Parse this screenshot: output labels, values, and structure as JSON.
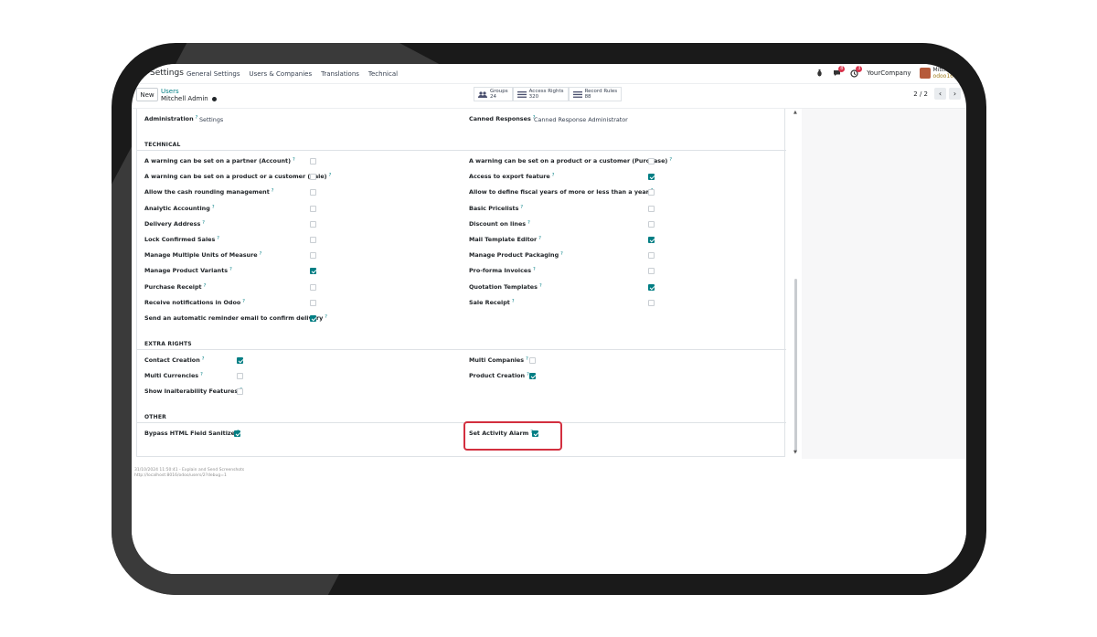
{
  "navbar": {
    "brand": "Settings",
    "menu": [
      "General Settings",
      "Users & Companies",
      "Translations",
      "Technical"
    ],
    "messages_badge": "8",
    "activity_badge": "3",
    "company": "YourCompany",
    "user_name": "Mitchel",
    "user_db": "odoo16"
  },
  "control_panel": {
    "new_label": "New",
    "breadcrumb_parent": "Users",
    "breadcrumb_current": "Mitchell Admin",
    "smart_buttons": [
      {
        "label": "Groups",
        "count": "24"
      },
      {
        "label": "Access Rights",
        "count": "320"
      },
      {
        "label": "Record Rules",
        "count": "88"
      }
    ],
    "pager": "2 / 2"
  },
  "form": {
    "admin_label": "Administration",
    "admin_value": "Settings",
    "canned_label": "Canned Responses",
    "canned_value": "Canned Response Administrator",
    "sections": {
      "technical": "TECHNICAL",
      "extra": "EXTRA RIGHTS",
      "other": "OTHER"
    },
    "technical_left": [
      {
        "label": "A warning can be set on a partner (Account)",
        "checked": false
      },
      {
        "label": "A warning can be set on a product or a customer (Sale)",
        "checked": false
      },
      {
        "label": "Allow the cash rounding management",
        "checked": false
      },
      {
        "label": "Analytic Accounting",
        "checked": false
      },
      {
        "label": "Delivery Address",
        "checked": false
      },
      {
        "label": "Lock Confirmed Sales",
        "checked": false
      },
      {
        "label": "Manage Multiple Units of Measure",
        "checked": false
      },
      {
        "label": "Manage Product Variants",
        "checked": true
      },
      {
        "label": "Purchase Receipt",
        "checked": false
      },
      {
        "label": "Receive notifications in Odoo",
        "checked": false
      },
      {
        "label": "Send an automatic reminder email to confirm delivery",
        "checked": true
      }
    ],
    "technical_right": [
      {
        "label": "A warning can be set on a product or a customer (Purchase)",
        "checked": false
      },
      {
        "label": "Access to export feature",
        "checked": true
      },
      {
        "label": "Allow to define fiscal years of more or less than a year",
        "checked": false
      },
      {
        "label": "Basic Pricelists",
        "checked": false
      },
      {
        "label": "Discount on lines",
        "checked": false
      },
      {
        "label": "Mail Template Editor",
        "checked": true
      },
      {
        "label": "Manage Product Packaging",
        "checked": false
      },
      {
        "label": "Pro-forma Invoices",
        "checked": false
      },
      {
        "label": "Quotation Templates",
        "checked": true
      },
      {
        "label": "Sale Receipt",
        "checked": false
      }
    ],
    "extra_left": [
      {
        "label": "Contact Creation",
        "checked": true
      },
      {
        "label": "Multi Currencies",
        "checked": false
      },
      {
        "label": "Show Inalterability Features",
        "checked": false
      }
    ],
    "extra_right": [
      {
        "label": "Multi Companies",
        "checked": false
      },
      {
        "label": "Product Creation",
        "checked": true
      }
    ],
    "other_left": [
      {
        "label": "Bypass HTML Field Sanitize",
        "checked": true
      }
    ],
    "other_right": [
      {
        "label": "Set Activity Alarm",
        "checked": true
      }
    ],
    "help_mark": "?"
  },
  "footer": {
    "line1": "31/10/2024 11:50:41 - Explain and Send Screenshots",
    "line2": "http://localhost:8016/odoo/users/2?debug=1"
  },
  "colors": {
    "accent": "#017e84",
    "highlight": "#d32f3f",
    "bezel": "#1a1a1a"
  }
}
